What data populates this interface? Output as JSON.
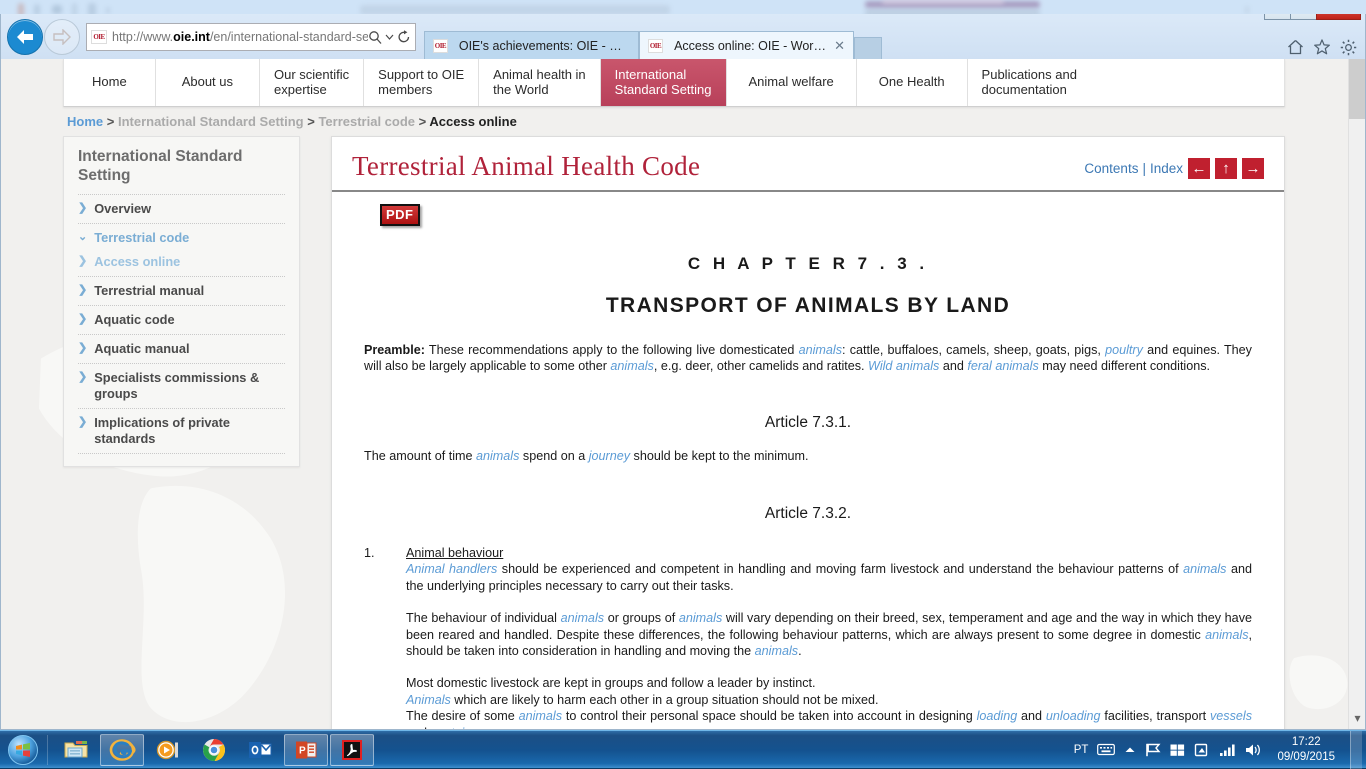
{
  "browser": {
    "address_url_prefix": "http://www.",
    "address_url_bold": "oie.int",
    "address_url_suffix": "/en/international-standard-setting/",
    "favicon_text": "OIE",
    "search_icon": "search-icon",
    "dropdown_icon": "chevron-down-icon",
    "refresh_icon": "refresh-icon",
    "back_icon": "back-arrow-icon",
    "forward_icon": "forward-arrow-icon",
    "tabs": [
      {
        "label": "OIE's achievements: OIE - Worl...",
        "active": false
      },
      {
        "label": "Access online: OIE - World ...",
        "active": true,
        "close": "✕"
      }
    ],
    "window_buttons": {
      "minimize": "—",
      "maximize": "❐",
      "close": "✕"
    },
    "chrome_icons": [
      "home-icon",
      "favorites-star-icon",
      "settings-gear-icon"
    ]
  },
  "site": {
    "nav": [
      {
        "label": "Home",
        "active": false
      },
      {
        "label": "About us",
        "active": false
      },
      {
        "label": "Our scientific\nexpertise",
        "active": false
      },
      {
        "label": "Support to OIE\nmembers",
        "active": false
      },
      {
        "label": "Animal health in\nthe World",
        "active": false
      },
      {
        "label": "International\nStandard Setting",
        "active": true
      },
      {
        "label": "Animal welfare",
        "active": false
      },
      {
        "label": "One Health",
        "active": false
      },
      {
        "label": "Publications and\ndocumentation",
        "active": false
      }
    ],
    "breadcrumb": {
      "home": "Home",
      "sep": ">",
      "level2": "International Standard Setting",
      "level3": "Terrestrial code",
      "current": "Access online"
    },
    "accent_red": "#b8405a",
    "link_blue": "#5b9bd5"
  },
  "sidebar": {
    "title": "International Standard Setting",
    "items": [
      {
        "label": "Overview",
        "state": "closed",
        "chevron": "❯"
      },
      {
        "label": "Terrestrial code",
        "state": "open",
        "chevron": "⌄"
      },
      {
        "label": "Terrestrial manual",
        "state": "closed",
        "chevron": "❯"
      },
      {
        "label": "Aquatic code",
        "state": "closed",
        "chevron": "❯"
      },
      {
        "label": "Aquatic manual",
        "state": "closed",
        "chevron": "❯"
      },
      {
        "label": "Specialists commissions & groups",
        "state": "closed",
        "chevron": "❯"
      },
      {
        "label": "Implications of private standards",
        "state": "closed",
        "chevron": "❯"
      }
    ],
    "sub_item": {
      "label": "Access online",
      "chevron": "❯"
    }
  },
  "document": {
    "title": "Terrestrial Animal Health Code",
    "links": {
      "contents": "Contents",
      "separator": "|",
      "index": "Index"
    },
    "nav_arrows": [
      {
        "name": "previous-arrow-icon",
        "glyph": "←"
      },
      {
        "name": "up-arrow-icon",
        "glyph": "↑"
      },
      {
        "name": "next-arrow-icon",
        "glyph": "→"
      }
    ],
    "pdf_badge": "PDF",
    "chapter_number": "C H A P T E R   7 . 3 .",
    "chapter_title": "TRANSPORT OF ANIMALS BY LAND",
    "preamble_label": "Preamble:",
    "preamble": {
      "s1": " These recommendations apply to the following live domesticated ",
      "t1": "animals",
      "s2": ": cattle, buffaloes, camels, sheep, goats, pigs, ",
      "t2": "poultry",
      "s3": " and equines. They will also be largely applicable to some other ",
      "t3": "animals",
      "s4": ", e.g. deer, other camelids and ratites. ",
      "t4": "Wild animals",
      "s5": " and ",
      "t5": "feral animals",
      "s6": " may need different conditions."
    },
    "article1": {
      "heading": "Article 7.3.1.",
      "s1": "The amount of time ",
      "t1": "animals",
      "s2": " spend on a ",
      "t2": "journey",
      "s3": " should be kept to the minimum."
    },
    "article2": {
      "heading": "Article 7.3.2.",
      "item_number": "1.",
      "item_title": "Animal behaviour",
      "p1": {
        "t1": "Animal handlers",
        "s1": " should be experienced and competent in handling and moving farm livestock and understand the behaviour patterns of ",
        "t2": "animals",
        "s2": " and the underlying principles necessary to carry out their tasks."
      },
      "p2": {
        "s1": "The behaviour of individual ",
        "t1": "animals",
        "s2": " or groups of ",
        "t2": "animals",
        "s3": " will vary depending on their breed, sex, temperament and age and the way in which they have been reared and handled. Despite these differences, the following behaviour patterns, which are always present to some degree in domestic ",
        "t3": "animals",
        "s4": ", should be taken into consideration in handling and moving the ",
        "t4": "animals",
        "s5": "."
      },
      "p3": {
        "l1": "Most domestic livestock are kept in groups and follow a leader by instinct.",
        "t1": "Animals",
        "l2": " which are likely to harm each other in a group situation should not be mixed.",
        "l3_a": "The desire of some ",
        "t2": "animals",
        "l3_b": " to control their personal space should be taken into account in designing ",
        "t3": "loading",
        "l3_c": " and ",
        "t4": "unloading",
        "l3_d": " facilities, transport ",
        "t5": "vessels",
        "l3_e": " and ",
        "t6": "containers",
        "l3_f": "."
      }
    }
  },
  "taskbar": {
    "start": "windows-start-orb",
    "pinned": [
      {
        "name": "file-explorer-icon",
        "active": false
      },
      {
        "name": "internet-explorer-icon",
        "active": true
      },
      {
        "name": "windows-media-player-icon",
        "active": false
      },
      {
        "name": "google-chrome-icon",
        "active": false
      },
      {
        "name": "outlook-icon",
        "active": false
      },
      {
        "name": "powerpoint-icon",
        "active": true
      },
      {
        "name": "adobe-acrobat-icon",
        "active": true
      }
    ],
    "tray": {
      "language": "PT",
      "keyboard_icon": "keyboard-icon",
      "show_hidden_icon": "chevron-up-icon",
      "flag_icon": "action-center-flag-icon",
      "windows_icon": "windows-update-icon",
      "network_icon": "network-icon",
      "signal_icon": "signal-bars-icon",
      "volume_icon": "volume-icon"
    },
    "time": "17:22",
    "date": "09/09/2015"
  }
}
